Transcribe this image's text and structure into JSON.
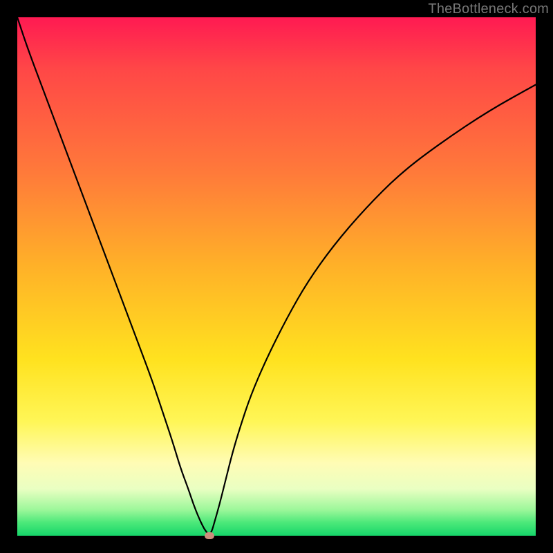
{
  "watermark": "TheBottleneck.com",
  "chart_data": {
    "type": "line",
    "title": "",
    "xlabel": "",
    "ylabel": "",
    "xlim": [
      0,
      100
    ],
    "ylim": [
      0,
      100
    ],
    "grid": false,
    "gradient_stops": [
      {
        "pos": 0,
        "color": "#ff1a52"
      },
      {
        "pos": 10,
        "color": "#ff4747"
      },
      {
        "pos": 30,
        "color": "#ff7a3a"
      },
      {
        "pos": 48,
        "color": "#ffb128"
      },
      {
        "pos": 66,
        "color": "#ffe21f"
      },
      {
        "pos": 78,
        "color": "#fff657"
      },
      {
        "pos": 86,
        "color": "#fffcb5"
      },
      {
        "pos": 91,
        "color": "#e9ffc2"
      },
      {
        "pos": 95,
        "color": "#9cf79a"
      },
      {
        "pos": 97.5,
        "color": "#4be879"
      },
      {
        "pos": 100,
        "color": "#16d66a"
      }
    ],
    "series": [
      {
        "name": "bottleneck-curve",
        "x": [
          0,
          2,
          5,
          8,
          11,
          14,
          17,
          20,
          23,
          26,
          28,
          30,
          31.5,
          33,
          34,
          35,
          35.8,
          36.4,
          37,
          37.5,
          38,
          39,
          40,
          41.5,
          43,
          45,
          48,
          52,
          56,
          61,
          67,
          74,
          82,
          91,
          100
        ],
        "y": [
          100,
          94,
          86,
          78,
          70,
          62,
          54,
          46,
          38,
          30,
          24,
          18,
          13,
          9,
          6,
          3.5,
          1.8,
          0.8,
          0.2,
          0.8,
          2.5,
          6,
          10,
          16,
          21,
          27,
          34,
          42,
          49,
          56,
          63,
          70,
          76,
          82,
          87
        ]
      }
    ],
    "optimum_point": {
      "x": 37,
      "y": 0
    },
    "optimum_marker_color": "#cc8e7d"
  }
}
